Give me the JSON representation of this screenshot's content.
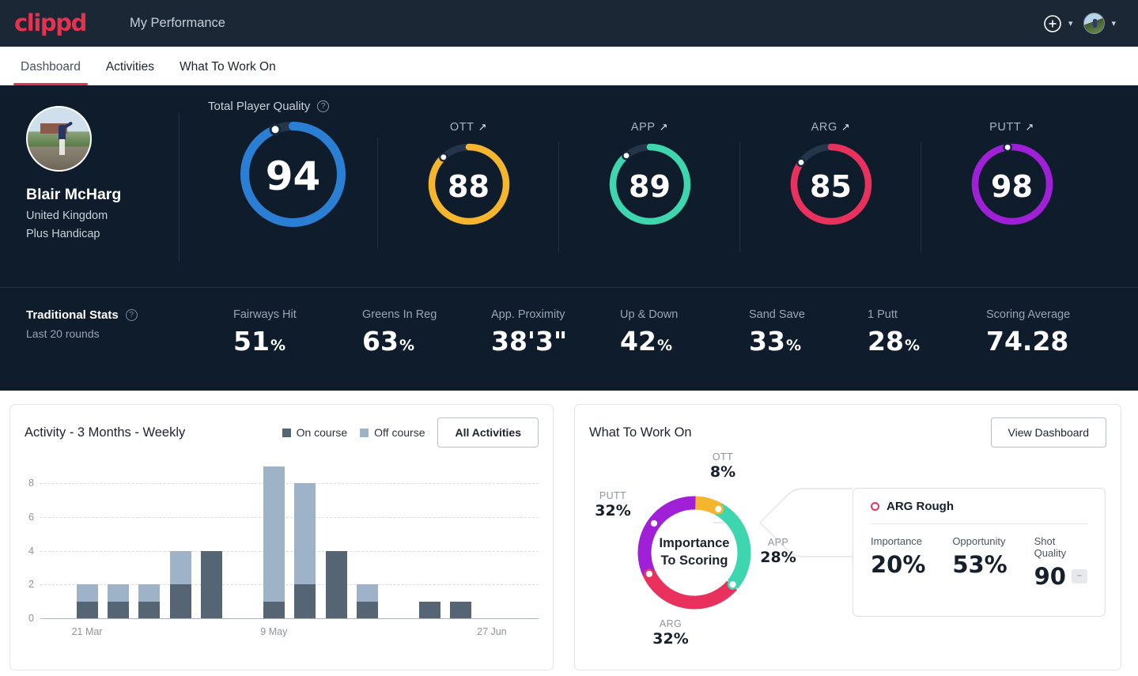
{
  "topbar": {
    "logo": "clippd",
    "title": "My Performance",
    "add_icon": "plus-circle-icon",
    "add_chevron": "chevron-down-icon",
    "avatar_chevron": "chevron-down-icon"
  },
  "tabs": [
    {
      "label": "Dashboard",
      "active": true
    },
    {
      "label": "Activities",
      "active": false
    },
    {
      "label": "What To Work On",
      "active": false
    }
  ],
  "profile": {
    "name": "Blair McHarg",
    "country": "United Kingdom",
    "handicap": "Plus Handicap"
  },
  "quality": {
    "section_label": "Total Player Quality",
    "help_icon": "help-circle-icon",
    "total": {
      "label": "",
      "value": "94",
      "percent": 94,
      "color": "#2a7fd4"
    },
    "gauges": [
      {
        "label": "OTT",
        "trend": "↗",
        "value": "88",
        "percent": 88,
        "color": "#f5b52c"
      },
      {
        "label": "APP",
        "trend": "↗",
        "value": "89",
        "percent": 89,
        "color": "#3ed6ae"
      },
      {
        "label": "ARG",
        "trend": "↗",
        "value": "85",
        "percent": 85,
        "color": "#e8315c"
      },
      {
        "label": "PUTT",
        "trend": "↗",
        "value": "98",
        "percent": 98,
        "color": "#a020d8"
      }
    ]
  },
  "traditional": {
    "title": "Traditional Stats",
    "help_icon": "help-circle-icon",
    "subtitle": "Last 20 rounds",
    "stats": [
      {
        "label": "Fairways Hit",
        "value": "51",
        "unit": "%"
      },
      {
        "label": "Greens In Reg",
        "value": "63",
        "unit": "%"
      },
      {
        "label": "App. Proximity",
        "value": "38'3\"",
        "unit": ""
      },
      {
        "label": "Up & Down",
        "value": "42",
        "unit": "%"
      },
      {
        "label": "Sand Save",
        "value": "33",
        "unit": "%"
      },
      {
        "label": "1 Putt",
        "value": "28",
        "unit": "%"
      },
      {
        "label": "Scoring Average",
        "value": "74.28",
        "unit": ""
      }
    ]
  },
  "activity_card": {
    "title": "Activity - 3 Months - Weekly",
    "legend": [
      {
        "label": "On course",
        "color": "#566573"
      },
      {
        "label": "Off course",
        "color": "#9fb3c8"
      }
    ],
    "button": "All Activities"
  },
  "wtwo_card": {
    "title": "What To Work On",
    "button": "View Dashboard",
    "center_line1": "Importance",
    "center_line2": "To Scoring",
    "segments": [
      {
        "label": "OTT",
        "value": "8%",
        "percent": 8,
        "color": "#f5b52c"
      },
      {
        "label": "APP",
        "value": "28%",
        "percent": 28,
        "color": "#3ed6ae"
      },
      {
        "label": "ARG",
        "value": "32%",
        "percent": 32,
        "color": "#e8315c"
      },
      {
        "label": "PUTT",
        "value": "32%",
        "percent": 32,
        "color": "#a020d8"
      }
    ],
    "detail": {
      "marker_icon": "ring-dot-icon",
      "marker_color": "#e8315c",
      "title": "ARG Rough",
      "stats": [
        {
          "label": "Importance",
          "value": "20%"
        },
        {
          "label": "Opportunity",
          "value": "53%"
        },
        {
          "label": "Shot Quality",
          "value": "90",
          "badge": "–"
        }
      ]
    }
  },
  "chart_data": {
    "type": "bar",
    "title": "Activity - 3 Months - Weekly",
    "stacked": true,
    "xlabel": "",
    "ylabel": "",
    "ylim": [
      0,
      9
    ],
    "yticks": [
      0,
      2,
      4,
      6,
      8
    ],
    "grid": true,
    "legend_position": "top-right",
    "categories": [
      "",
      "21 Mar",
      "",
      "",
      "",
      "",
      "",
      "9 May",
      "",
      "",
      "",
      "",
      "",
      "",
      "27 Jun",
      ""
    ],
    "xtick_labels": [
      {
        "index": 1,
        "label": "21 Mar"
      },
      {
        "index": 7,
        "label": "9 May"
      },
      {
        "index": 14,
        "label": "27 Jun"
      }
    ],
    "series": [
      {
        "name": "On course",
        "color": "#566573",
        "values": [
          0,
          1,
          1,
          1,
          2,
          4,
          0,
          1,
          2,
          4,
          1,
          0,
          1,
          1,
          0,
          0
        ]
      },
      {
        "name": "Off course",
        "color": "#9fb3c8",
        "values": [
          0,
          1,
          1,
          1,
          2,
          0,
          0,
          8,
          6,
          0,
          1,
          0,
          0,
          0,
          0,
          0
        ]
      }
    ],
    "totals": [
      0,
      2,
      2,
      2,
      4,
      4,
      0,
      9,
      8,
      4,
      2,
      0,
      1,
      1,
      0,
      0
    ]
  }
}
